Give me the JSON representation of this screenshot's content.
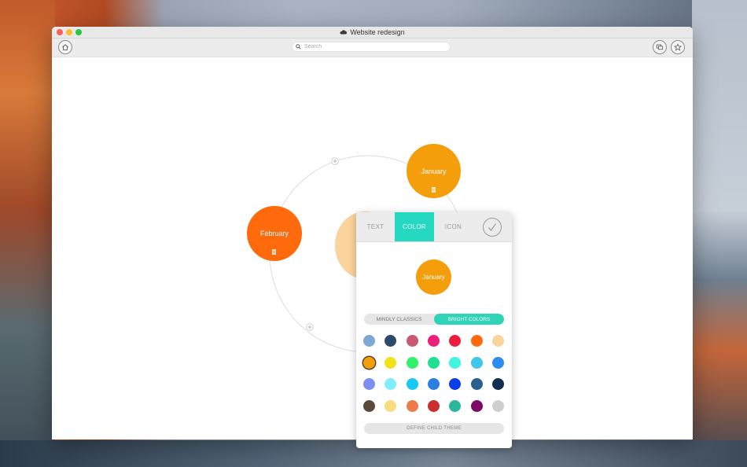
{
  "window": {
    "title": "Website redesign"
  },
  "toolbar": {
    "search_placeholder": "Search",
    "home_icon": "home-icon",
    "present_icon": "presentation-icon",
    "favorite_icon": "star-icon"
  },
  "map": {
    "nodes": [
      {
        "label": "January",
        "color": "#f59e0b",
        "has_note": true
      },
      {
        "label": "February",
        "color": "#ff6a0d",
        "has_note": true
      },
      {
        "label": "",
        "color": "#fbd39c",
        "has_note": false
      }
    ]
  },
  "popover": {
    "tabs": [
      "TEXT",
      "COLOR",
      "ICON"
    ],
    "active_tab": "COLOR",
    "preview_label": "January",
    "segments": [
      "MINDLY CLASSICS",
      "BRIGHT COLORS"
    ],
    "active_segment": "BRIGHT COLORS",
    "define_label": "DEFINE CHILD THEME",
    "selected_color": "#f59e0b",
    "swatch_rows": [
      [
        "#7ea8d4",
        "#2c4a6e",
        "#c75a70",
        "#ee1f7a",
        "#ed1c3c",
        "#ff6a0d",
        "#fbd39c"
      ],
      [
        "#f59e0b",
        "#f2e21a",
        "#31f26b",
        "#1fe08f",
        "#3ff5e0",
        "#3fc6e8",
        "#2d8cf0"
      ],
      [
        "#7b8ff0",
        "#7fefff",
        "#18c9f5",
        "#2b7fe0",
        "#0a3fe8",
        "#2b5f8e",
        "#0e2f4f"
      ],
      [
        "#5a4a3c",
        "#fadc80",
        "#ee7b4a",
        "#c92f30",
        "#2bb89a",
        "#7c0a66",
        "#cfcfcf"
      ]
    ]
  }
}
